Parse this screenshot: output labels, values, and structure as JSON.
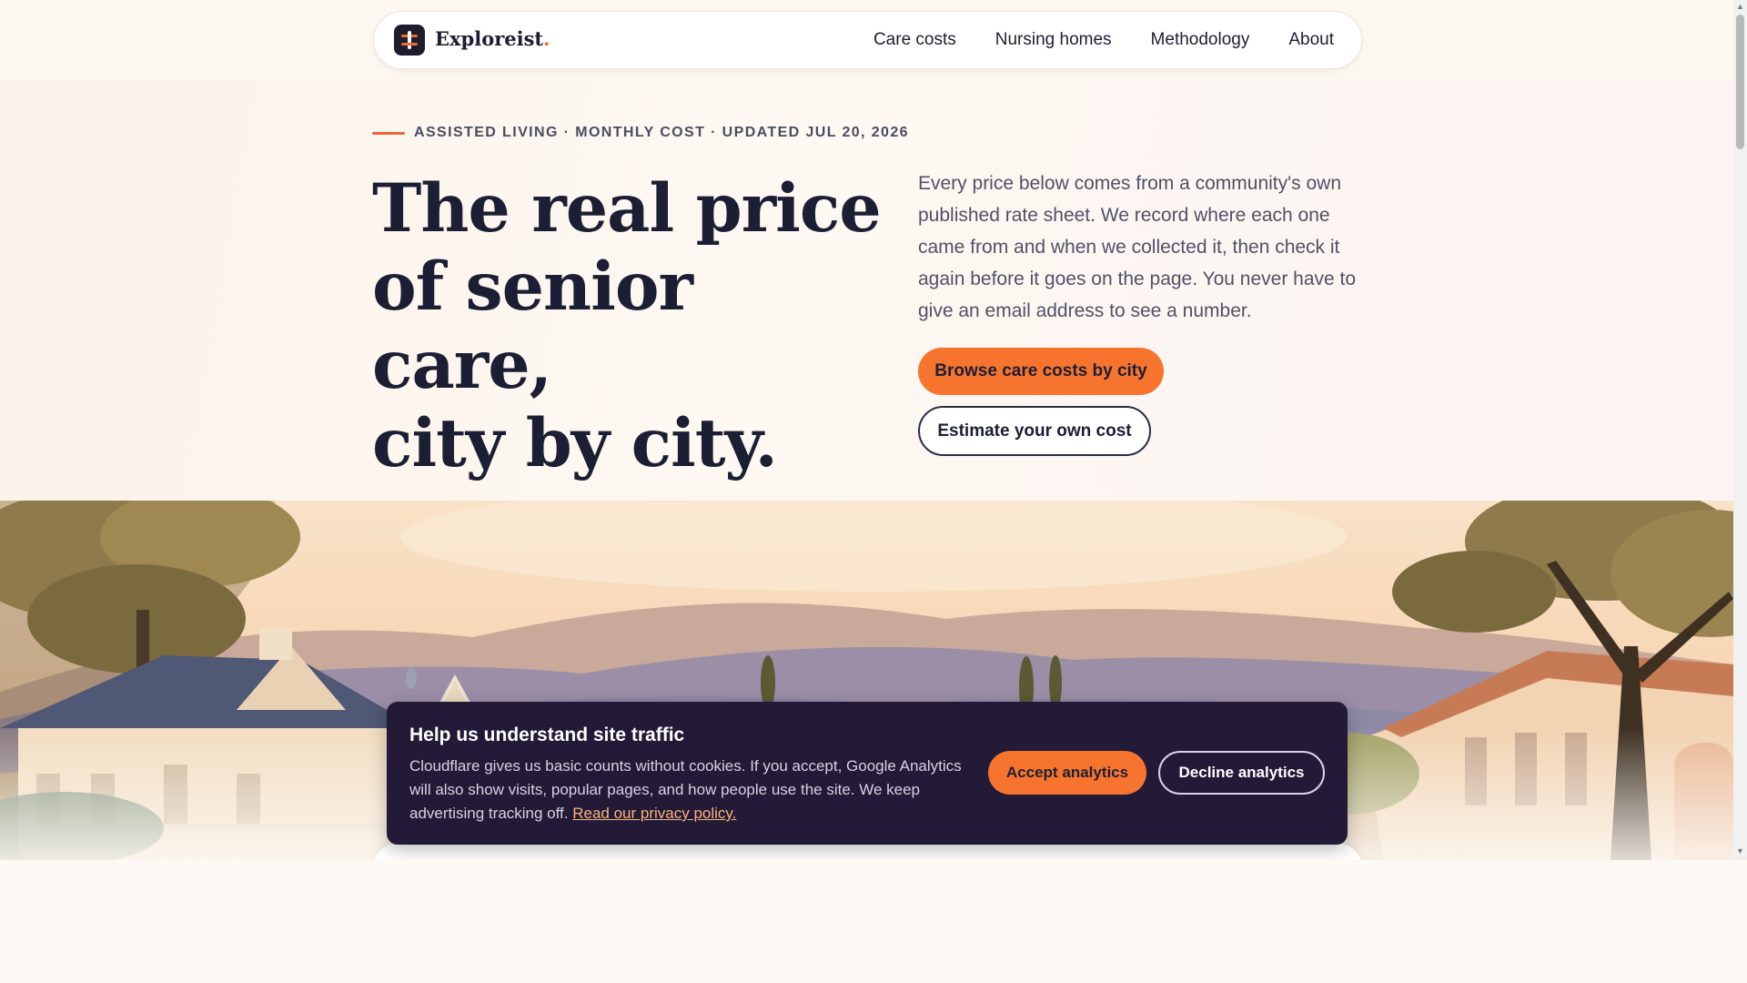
{
  "brand": {
    "name": "Exploreist",
    "dot": "."
  },
  "nav": {
    "items": [
      {
        "label": "Care costs"
      },
      {
        "label": "Nursing homes"
      },
      {
        "label": "Methodology"
      },
      {
        "label": "About"
      }
    ]
  },
  "hero": {
    "eyebrow": "ASSISTED LIVING · MONTHLY COST · UPDATED JUL 20, 2026",
    "headline_line1": "The real price",
    "headline_line2": "of senior care,",
    "headline_line3": "city by city.",
    "intro": "Every price below comes from a community's own published rate sheet. We record where each one came from and when we collected it, then check it again before it goes on the page. You never have to give an email address to see a number.",
    "primary_cta": "Browse care costs by city",
    "secondary_cta": "Estimate your own cost"
  },
  "cookie_banner": {
    "title": "Help us understand site traffic",
    "body": "Cloudflare gives us basic counts without cookies. If you accept, Google Analytics will also show visits, popular pages, and how people use the site. We keep advertising tracking off.",
    "link": "Read our privacy policy.",
    "accept_label": "Accept analytics",
    "decline_label": "Decline analytics"
  },
  "colors": {
    "accent": "#f7742e",
    "ink": "#1c1f33",
    "banner_bg": "#231a38"
  }
}
